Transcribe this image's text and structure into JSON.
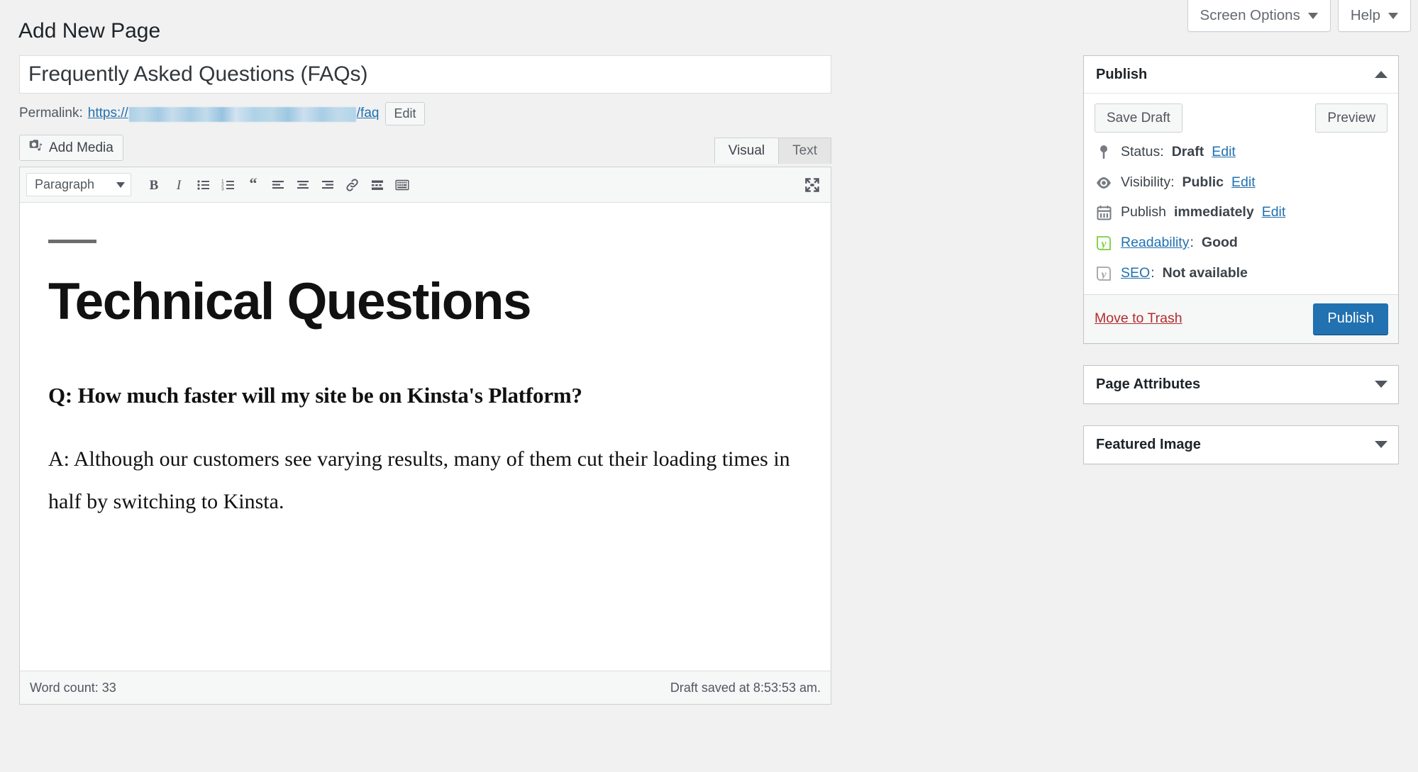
{
  "topbar": {
    "screen_options_label": "Screen Options",
    "help_label": "Help"
  },
  "page": {
    "heading": "Add New Page"
  },
  "editor": {
    "title_value": "Frequently Asked Questions (FAQs)",
    "title_placeholder": "Enter title here",
    "permalink_label": "Permalink:",
    "permalink_protocol": "https://",
    "permalink_slug": "/faq",
    "permalink_edit_label": "Edit",
    "add_media_label": "Add Media",
    "tabs": {
      "visual": "Visual",
      "text": "Text"
    },
    "toolbar": {
      "format_value": "Paragraph",
      "bold": "Bold",
      "italic": "Italic",
      "bulleted_list": "Bulleted list",
      "numbered_list": "Numbered list",
      "blockquote": "Blockquote",
      "align_left": "Align left",
      "align_center": "Align center",
      "align_right": "Align right",
      "insert_link": "Insert/edit link",
      "read_more": "Insert Read More tag",
      "keyboard_shortcuts": "Keyboard shortcuts",
      "fullscreen": "Distraction-free writing mode"
    },
    "content": {
      "heading": "Technical Questions",
      "question": "Q: How much faster will my site be on Kinsta's Platform?",
      "answer": "A: Although our customers see varying results, many of them cut their loading times in half by switching to Kinsta."
    },
    "status": {
      "word_count": "Word count: 33",
      "draft_saved": "Draft saved at 8:53:53 am."
    }
  },
  "sidebar": {
    "publish": {
      "title": "Publish",
      "save_draft_label": "Save Draft",
      "preview_label": "Preview",
      "status_label": "Status:",
      "status_value": "Draft",
      "status_edit": "Edit",
      "visibility_label": "Visibility:",
      "visibility_value": "Public",
      "visibility_edit": "Edit",
      "publish_label": "Publish",
      "publish_time_value": "immediately",
      "publish_time_edit": "Edit",
      "readability_label": "Readability",
      "readability_sep": ":",
      "readability_value": "Good",
      "seo_label": "SEO",
      "seo_sep": ":",
      "seo_value": "Not available",
      "trash_label": "Move to Trash",
      "publish_button_label": "Publish"
    },
    "page_attributes": {
      "title": "Page Attributes"
    },
    "featured_image": {
      "title": "Featured Image"
    }
  },
  "colors": {
    "accent": "#2271b1",
    "danger": "#b32d2e",
    "readability_good": "#7ad03a",
    "seo_na": "#a4a4a4",
    "page_bg": "#f1f1f1"
  }
}
